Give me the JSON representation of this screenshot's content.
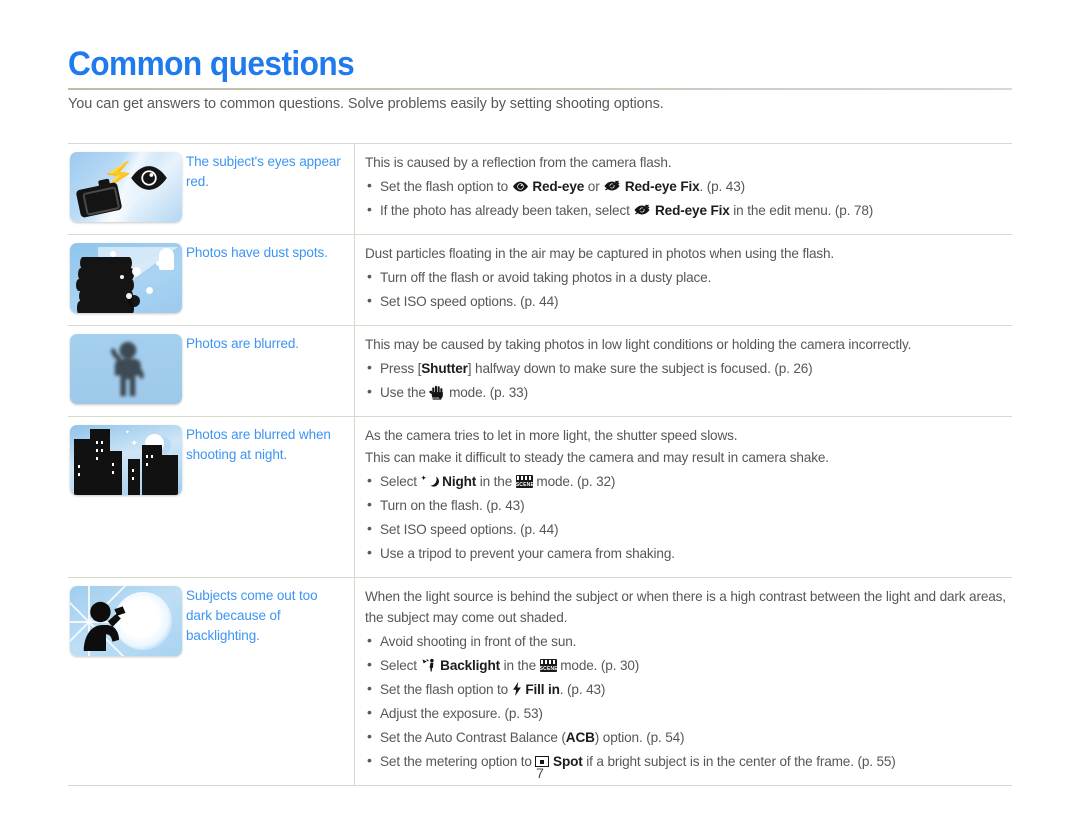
{
  "header": {
    "title": "Common questions",
    "intro": "You can get answers to common questions. Solve problems easily by setting shooting options."
  },
  "footer": {
    "page_number": "7"
  },
  "colors": {
    "title_blue": "#1f7bed",
    "label_blue": "#3d94f2",
    "body_gray": "#575757",
    "rule": "#d7d9c9"
  },
  "rows": [
    {
      "thumb_name": "red-eye-thumbnail",
      "thumb_alt": "camera-flash-and-eye",
      "label": "The subject's eyes appear red.",
      "lead": "This is caused by a reflection from the camera flash.",
      "bullets": [
        {
          "parts": [
            {
              "t": "text",
              "v": "Set the flash option to "
            },
            {
              "t": "icon",
              "v": "red-eye-icon"
            },
            {
              "t": "bold",
              "v": "Red-eye"
            },
            {
              "t": "text",
              "v": " or "
            },
            {
              "t": "icon",
              "v": "red-eye-fix-icon"
            },
            {
              "t": "bold",
              "v": "Red-eye Fix"
            },
            {
              "t": "text",
              "v": ". (p. 43)"
            }
          ]
        },
        {
          "parts": [
            {
              "t": "text",
              "v": "If the photo has already been taken, select "
            },
            {
              "t": "icon",
              "v": "red-eye-fix-icon"
            },
            {
              "t": "bold",
              "v": "Red-eye Fix"
            },
            {
              "t": "text",
              "v": " in the edit menu. (p. 78)"
            }
          ]
        }
      ]
    },
    {
      "thumb_name": "dust-spots-thumbnail",
      "thumb_alt": "dusty-books-with-flash-beam",
      "label": "Photos have dust spots.",
      "lead": "Dust particles floating in the air may be captured in photos when using the flash.",
      "bullets": [
        {
          "parts": [
            {
              "t": "text",
              "v": "Turn off the flash or avoid taking photos in a dusty place."
            }
          ]
        },
        {
          "parts": [
            {
              "t": "text",
              "v": "Set ISO speed options. (p. 44)"
            }
          ]
        }
      ]
    },
    {
      "thumb_name": "blurred-photo-thumbnail",
      "thumb_alt": "blurred-person-figure",
      "label": "Photos are blurred.",
      "lead": "This may be caused by taking photos in low light conditions or holding the camera incorrectly.",
      "bullets": [
        {
          "parts": [
            {
              "t": "text",
              "v": "Press ["
            },
            {
              "t": "bold",
              "v": "Shutter"
            },
            {
              "t": "text",
              "v": "] halfway down to make sure the subject is focused. (p. 26)"
            }
          ]
        },
        {
          "parts": [
            {
              "t": "text",
              "v": "Use the "
            },
            {
              "t": "icon",
              "v": "dual-is-hand-icon"
            },
            {
              "t": "text",
              "v": " mode. (p. 33)"
            }
          ]
        }
      ]
    },
    {
      "thumb_name": "night-blur-thumbnail",
      "thumb_alt": "city-skyline-at-night-with-moon",
      "label": "Photos are blurred when shooting at night.",
      "lead": "As the camera tries to let in more light, the shutter speed slows.",
      "lead2": "This can make it difficult to steady the camera and may result in camera shake.",
      "bullets": [
        {
          "parts": [
            {
              "t": "text",
              "v": "Select "
            },
            {
              "t": "icon",
              "v": "night-mode-icon"
            },
            {
              "t": "bold",
              "v": "Night"
            },
            {
              "t": "text",
              "v": " in the "
            },
            {
              "t": "icon",
              "v": "scene-mode-icon"
            },
            {
              "t": "text",
              "v": " mode. (p. 32)"
            }
          ]
        },
        {
          "parts": [
            {
              "t": "text",
              "v": "Turn on the flash. (p. 43)"
            }
          ]
        },
        {
          "parts": [
            {
              "t": "text",
              "v": "Set ISO speed options. (p. 44)"
            }
          ]
        },
        {
          "parts": [
            {
              "t": "text",
              "v": "Use a tripod to prevent your camera from shaking."
            }
          ]
        }
      ]
    },
    {
      "thumb_name": "backlight-thumbnail",
      "thumb_alt": "person-silhouette-in-front-of-sun",
      "label": "Subjects come out too dark because of backlighting.",
      "lead": "When the light source is behind the subject or when there is a high contrast between the light and dark areas, the subject may come out shaded.",
      "bullets": [
        {
          "parts": [
            {
              "t": "text",
              "v": "Avoid shooting in front of the sun."
            }
          ]
        },
        {
          "parts": [
            {
              "t": "text",
              "v": "Select "
            },
            {
              "t": "icon",
              "v": "backlight-mode-icon"
            },
            {
              "t": "bold",
              "v": "Backlight"
            },
            {
              "t": "text",
              "v": " in the "
            },
            {
              "t": "icon",
              "v": "scene-mode-icon"
            },
            {
              "t": "text",
              "v": " mode. (p. 30)"
            }
          ]
        },
        {
          "parts": [
            {
              "t": "text",
              "v": "Set the flash option to "
            },
            {
              "t": "icon",
              "v": "fill-in-flash-icon"
            },
            {
              "t": "bold",
              "v": "Fill in"
            },
            {
              "t": "text",
              "v": ". (p. 43)"
            }
          ]
        },
        {
          "parts": [
            {
              "t": "text",
              "v": "Adjust the exposure. (p. 53)"
            }
          ]
        },
        {
          "parts": [
            {
              "t": "text",
              "v": "Set the Auto Contrast Balance ("
            },
            {
              "t": "bold",
              "v": "ACB"
            },
            {
              "t": "text",
              "v": ") option. (p. 54)"
            }
          ]
        },
        {
          "parts": [
            {
              "t": "text",
              "v": "Set the metering option to "
            },
            {
              "t": "icon",
              "v": "spot-metering-icon"
            },
            {
              "t": "bold",
              "v": "Spot"
            },
            {
              "t": "text",
              "v": " if a bright subject is in the center of the frame. (p. 55)"
            }
          ]
        }
      ]
    }
  ]
}
